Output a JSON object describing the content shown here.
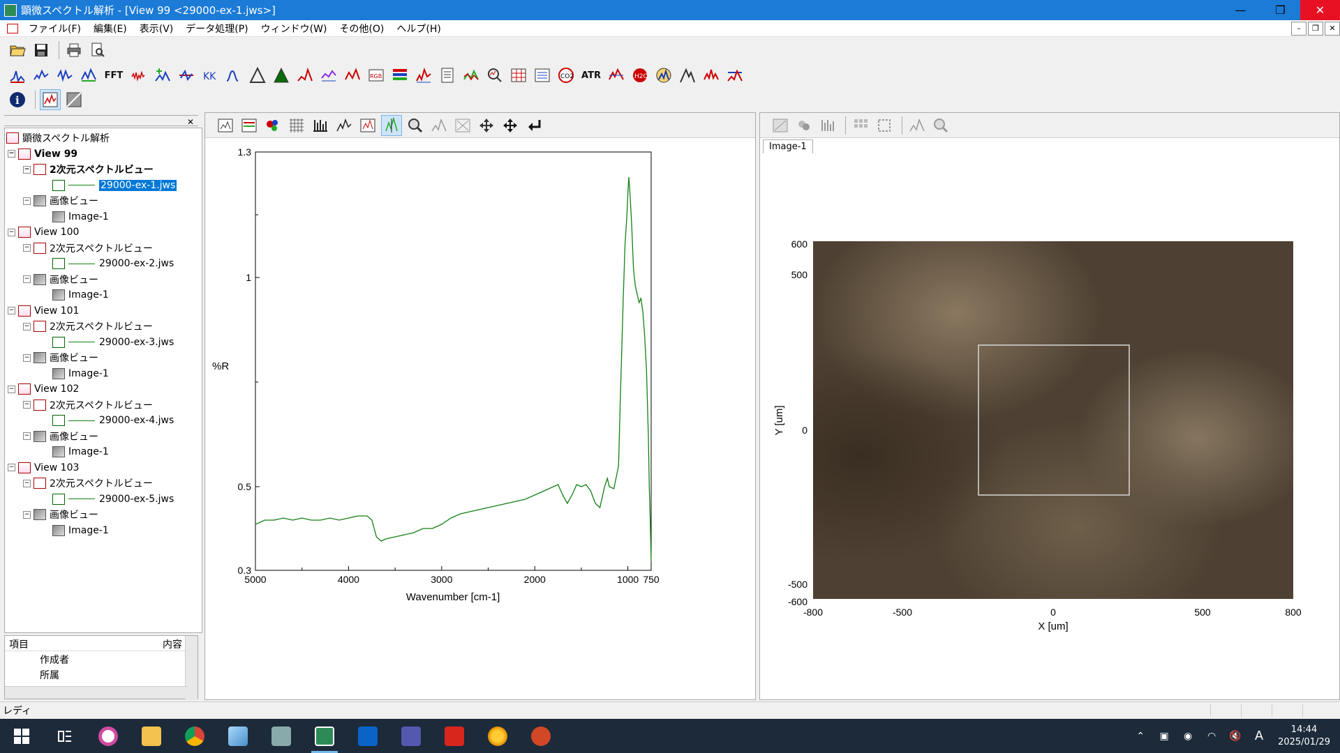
{
  "window": {
    "title": "顕微スペクトル解析 - [View 99 <29000-ex-1.jws>]",
    "controls": {
      "minimize": "—",
      "restore": "❐",
      "close": "✕"
    }
  },
  "menu": {
    "items": [
      "ファイル(F)",
      "編集(E)",
      "表示(V)",
      "データ処理(P)",
      "ウィンドウ(W)",
      "その他(O)",
      "ヘルプ(H)"
    ],
    "mdi_controls": {
      "minimize": "–",
      "restore": "❐",
      "close": "✕"
    }
  },
  "toolbar2": {
    "fft_label": "FFT",
    "atr_label": "ATR"
  },
  "tree": {
    "root": "顕微スペクトル解析",
    "views": [
      {
        "view": "View 99",
        "spectrum_view": "2次元スペクトルビュー",
        "file": "29000-ex-1.jws",
        "image_view": "画像ビュー",
        "image": "Image-1"
      },
      {
        "view": "View 100",
        "spectrum_view": "2次元スペクトルビュー",
        "file": "29000-ex-2.jws",
        "image_view": "画像ビュー",
        "image": "Image-1"
      },
      {
        "view": "View 101",
        "spectrum_view": "2次元スペクトルビュー",
        "file": "29000-ex-3.jws",
        "image_view": "画像ビュー",
        "image": "Image-1"
      },
      {
        "view": "View 102",
        "spectrum_view": "2次元スペクトルビュー",
        "file": "29000-ex-4.jws",
        "image_view": "画像ビュー",
        "image": "Image-1"
      },
      {
        "view": "View 103",
        "spectrum_view": "2次元スペクトルビュー",
        "file": "29000-ex-5.jws",
        "image_view": "画像ビュー",
        "image": "Image-1"
      }
    ]
  },
  "properties": {
    "col_item": "項目",
    "col_content": "内容",
    "rows": [
      "作成者",
      "所属"
    ]
  },
  "spectrum": {
    "ylabel": "%R",
    "xlabel": "Wavenumber [cm-1]",
    "x_ticks": [
      "5000",
      "4000",
      "3000",
      "2000",
      "1000",
      "750"
    ],
    "y_ticks": [
      "1.3",
      "1",
      "0.5",
      "0.3"
    ]
  },
  "chart_data": {
    "type": "line",
    "title": "",
    "xlabel": "Wavenumber [cm-1]",
    "ylabel": "%R",
    "xlim": [
      5000,
      750
    ],
    "ylim": [
      0.3,
      1.3
    ],
    "series": [
      {
        "color": "#128012",
        "x": [
          5000,
          4900,
          4800,
          4700,
          4600,
          4500,
          4400,
          4300,
          4200,
          4100,
          4000,
          3900,
          3800,
          3750,
          3700,
          3650,
          3600,
          3500,
          3400,
          3300,
          3200,
          3100,
          3000,
          2900,
          2800,
          2700,
          2600,
          2500,
          2400,
          2300,
          2200,
          2100,
          2000,
          1900,
          1800,
          1750,
          1700,
          1650,
          1600,
          1550,
          1500,
          1450,
          1400,
          1350,
          1300,
          1250,
          1220,
          1200,
          1150,
          1100,
          1080,
          1050,
          1030,
          1010,
          1000,
          990,
          980,
          960,
          940,
          920,
          900,
          880,
          860,
          840,
          820,
          800,
          780,
          770,
          760,
          750
        ],
        "y": [
          0.41,
          0.42,
          0.42,
          0.425,
          0.42,
          0.425,
          0.42,
          0.42,
          0.425,
          0.42,
          0.425,
          0.43,
          0.43,
          0.42,
          0.38,
          0.37,
          0.375,
          0.38,
          0.385,
          0.39,
          0.4,
          0.4,
          0.41,
          0.425,
          0.435,
          0.44,
          0.445,
          0.45,
          0.455,
          0.46,
          0.465,
          0.47,
          0.48,
          0.49,
          0.5,
          0.505,
          0.48,
          0.46,
          0.48,
          0.505,
          0.5,
          0.505,
          0.49,
          0.46,
          0.45,
          0.5,
          0.52,
          0.5,
          0.495,
          0.55,
          0.72,
          0.95,
          1.08,
          1.15,
          1.2,
          1.24,
          1.21,
          1.13,
          1.02,
          0.98,
          0.96,
          0.94,
          0.95,
          0.92,
          0.86,
          0.78,
          0.62,
          0.5,
          0.42,
          0.32
        ]
      }
    ]
  },
  "image_view": {
    "tab": "Image-1",
    "xlabel": "X [um]",
    "ylabel": "Y [um]",
    "x_ticks": [
      "-800",
      "-500",
      "0",
      "500",
      "800"
    ],
    "y_ticks": [
      "600",
      "500",
      "0",
      "-500",
      "-600"
    ]
  },
  "status": {
    "text": "レディ"
  },
  "taskbar": {
    "time": "14:44",
    "date": "2025/01/29",
    "ime": "A"
  }
}
